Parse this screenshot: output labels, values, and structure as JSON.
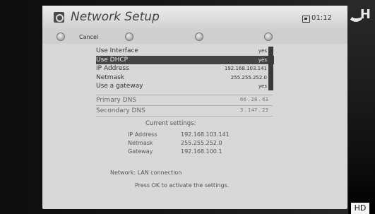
{
  "header": {
    "title": "Network Setup",
    "clock": "01:12"
  },
  "buttons": {
    "cancel_label": "Cancel"
  },
  "list": {
    "items": [
      {
        "label": "Use Interface",
        "value": "yes"
      },
      {
        "label": "Use DHCP",
        "value": "yes"
      },
      {
        "label": "IP Address",
        "value": "192.168.103.141"
      },
      {
        "label": "Netmask",
        "value": "255.255.252.0"
      },
      {
        "label": "Use a gateway",
        "value": "yes"
      }
    ],
    "selected_index": 1
  },
  "dns": {
    "primary_label": "Primary DNS",
    "primary_value": "66 . 28 . 63",
    "secondary_label": "Secondary DNS",
    "secondary_value": "3 . 147 . 23"
  },
  "current": {
    "heading": "Current settings:",
    "ip_label": "IP Address",
    "ip_value": "192.168.103.141",
    "netmask_label": "Netmask",
    "netmask_value": "255.255.252.0",
    "gateway_label": "Gateway",
    "gateway_value": "192.168.100.1"
  },
  "network": {
    "label": "Network:",
    "value": "LAN connection"
  },
  "hint": "Press OK to activate the settings.",
  "badges": {
    "hd": "HD",
    "corner_letter": "H"
  },
  "colors": {
    "panel": "#d8d8d8",
    "selected_row": "#444444",
    "frame": "#111111"
  },
  "icons": {
    "header": "gear-icon",
    "clock": "clock-icon",
    "buttons": "round-button-icon"
  }
}
